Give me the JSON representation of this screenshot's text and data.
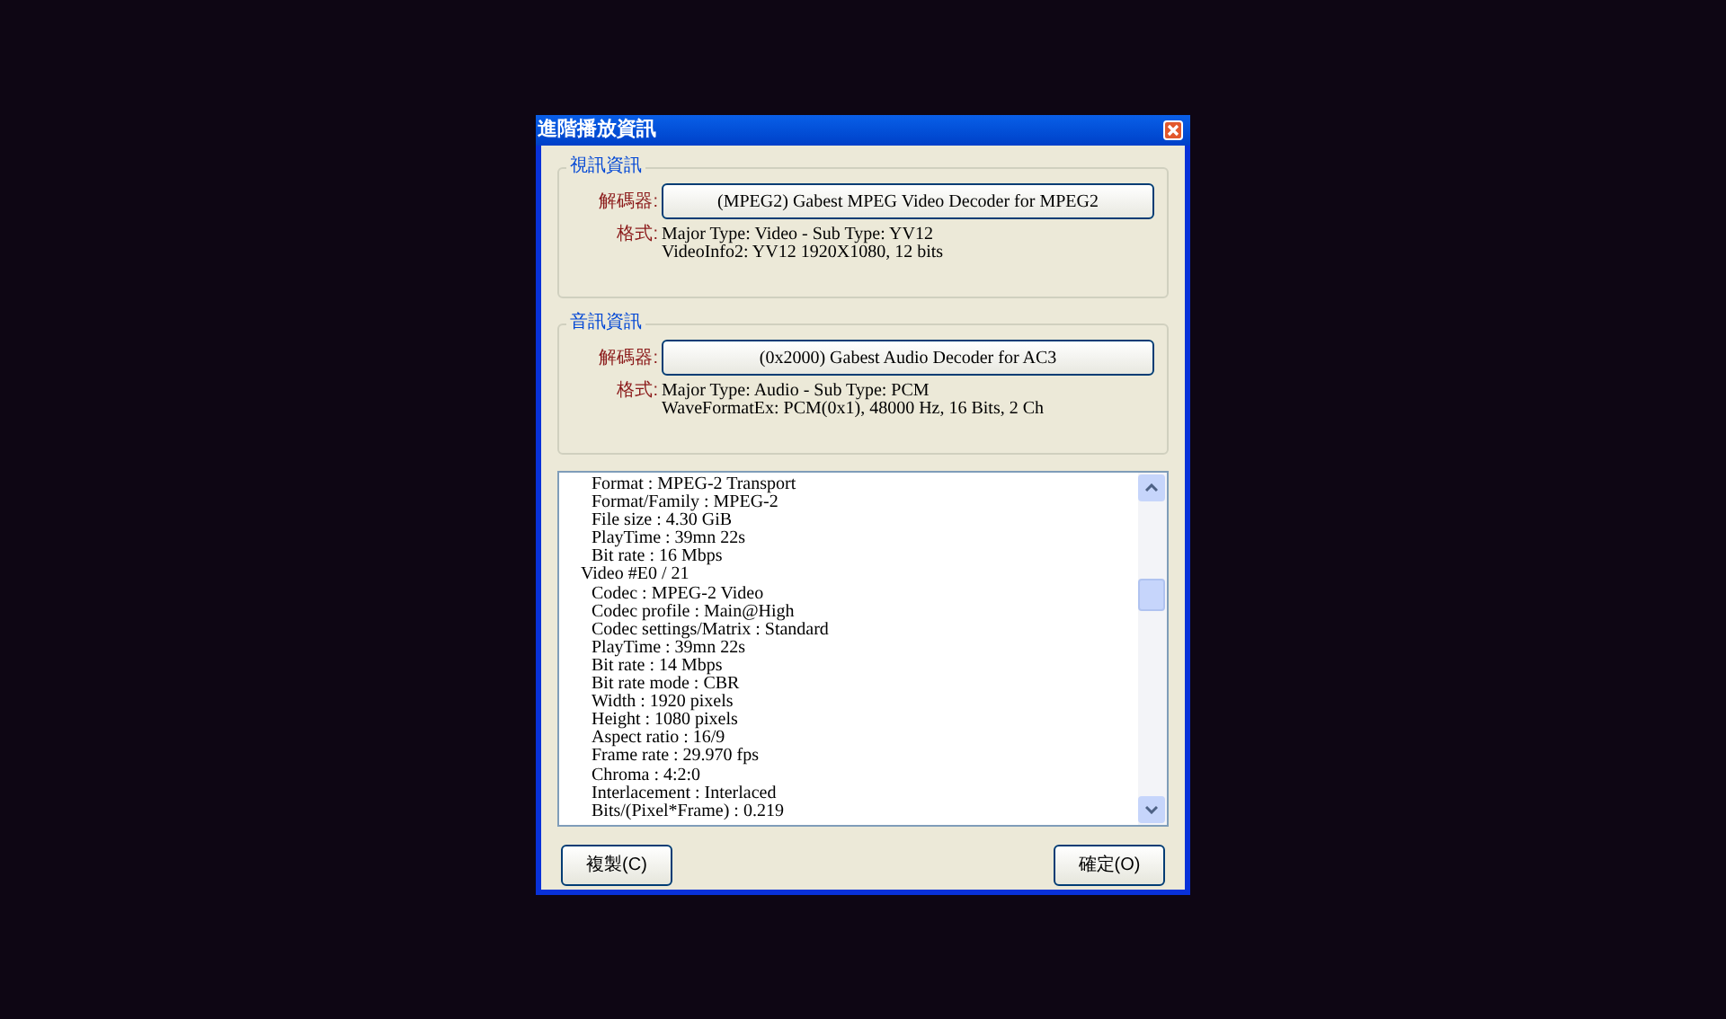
{
  "window": {
    "title": "進階播放資訊"
  },
  "video_group": {
    "title": "視訊資訊",
    "decoder_label": "解碼器:",
    "decoder_button": "(MPEG2) Gabest MPEG Video Decoder for MPEG2",
    "format_label": "格式:",
    "format_lines": [
      "Major Type: Video - Sub Type: YV12",
      "VideoInfo2: YV12 1920X1080, 12 bits"
    ]
  },
  "audio_group": {
    "title": "音訊資訊",
    "decoder_label": "解碼器:",
    "decoder_button": "(0x2000) Gabest Audio Decoder for AC3",
    "format_label": "格式:",
    "format_lines": [
      "Major Type: Audio - Sub Type: PCM",
      "WaveFormatEx: PCM(0x1), 48000 Hz, 16 Bits, 2 Ch"
    ]
  },
  "info_list": {
    "continued_lines": [
      "Format : MPEG-2 Transport",
      "Format/Family : MPEG-2",
      "File size : 4.30 GiB",
      "PlayTime : 39mn 22s",
      "Bit rate : 16 Mbps"
    ],
    "sections": [
      {
        "title": "Video #E0 / 21",
        "children": [
          "Codec : MPEG-2 Video",
          "Codec profile : Main@High",
          "Codec settings/Matrix : Standard",
          "PlayTime : 39mn 22s",
          "Bit rate : 14 Mbps",
          "Bit rate mode : CBR",
          "Width : 1920 pixels",
          "Height : 1080 pixels",
          "Aspect ratio : 16/9",
          "Frame rate : 29.970 fps",
          "Chroma : 4:2:0",
          "Interlacement : Interlaced",
          "Bits/(Pixel*Frame) : 0.219"
        ]
      }
    ]
  },
  "buttons": [
    {
      "label": "複製(C)"
    },
    {
      "label": "確定(O)"
    }
  ]
}
